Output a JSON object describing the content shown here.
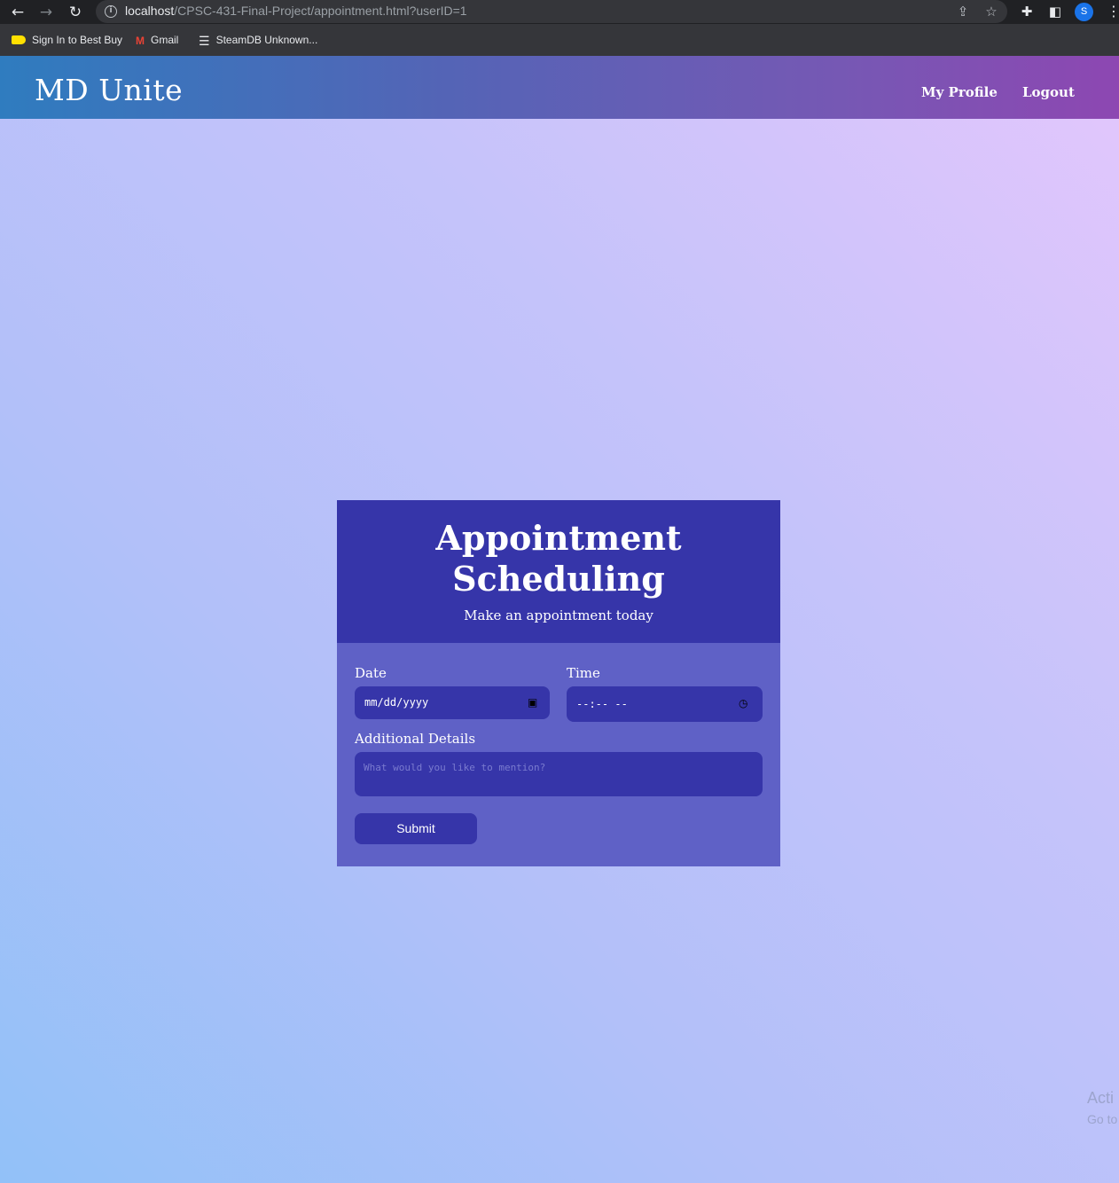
{
  "browser": {
    "url_host": "localhost",
    "url_path": "/CPSC-431-Final-Project/appointment.html?userID=1",
    "profile_initial": "S",
    "bookmarks": [
      {
        "label": "Sign In to Best Buy",
        "icon": "tag-icon"
      },
      {
        "label": "Gmail",
        "icon": "gmail-icon"
      },
      {
        "label": "SteamDB Unknown...",
        "icon": "steamdb-icon"
      }
    ]
  },
  "header": {
    "brand": "MD Unite",
    "nav": [
      {
        "label": "My Profile"
      },
      {
        "label": "Logout"
      }
    ]
  },
  "form": {
    "title_line1": "Appointment",
    "title_line2": "Scheduling",
    "subtitle": "Make an appointment today",
    "date_label": "Date",
    "date_value": "mm/dd/yyyy",
    "time_label": "Time",
    "time_value": "--:-- --",
    "details_label": "Additional Details",
    "details_placeholder": "What would you like to mention?",
    "submit_label": "Submit"
  },
  "watermark": {
    "line1": "Acti",
    "line2": "Go to"
  },
  "colors": {
    "header_start": "#2f7cbf",
    "header_end": "#8d47b2",
    "card_head": "#3635a9",
    "card_body": "#5f61c6"
  }
}
